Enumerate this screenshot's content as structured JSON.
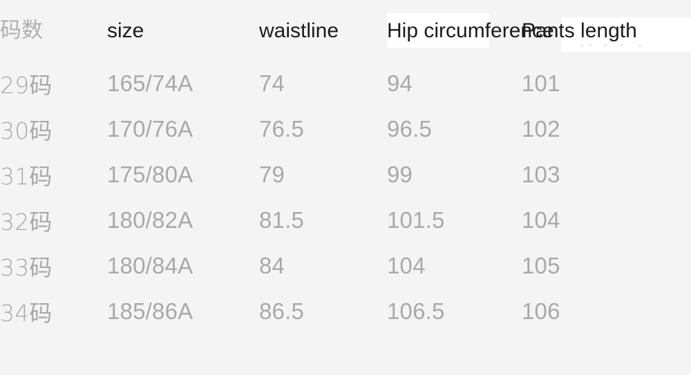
{
  "table": {
    "headers": [
      {
        "label": "码数",
        "style": "muted"
      },
      {
        "label": "size",
        "style": "dark"
      },
      {
        "label": "waistline",
        "style": "dark"
      },
      {
        "label": "Hip circumference",
        "style": "dark"
      },
      {
        "label": "Pants length",
        "style": "dark"
      }
    ],
    "rows": [
      {
        "code": "29码",
        "size": "165/74A",
        "waistline": "74",
        "hip": "94",
        "length": "101"
      },
      {
        "code": "30码",
        "size": "170/76A",
        "waistline": "76.5",
        "hip": "96.5",
        "length": "102"
      },
      {
        "code": "31码",
        "size": "175/80A",
        "waistline": "79",
        "hip": "99",
        "length": "103"
      },
      {
        "code": "32码",
        "size": "180/82A",
        "waistline": "81.5",
        "hip": "101.5",
        "length": "104"
      },
      {
        "code": "33码",
        "size": "180/84A",
        "waistline": "84",
        "hip": "104",
        "length": "105"
      },
      {
        "code": "34码",
        "size": "185/86A",
        "waistline": "86.5",
        "hip": "106.5",
        "length": "106"
      }
    ]
  },
  "colors": {
    "background": "#f4f4f4",
    "header_text": "#1b1b1b",
    "muted_text": "#b0b0b0",
    "data_text": "#a9a9a9",
    "highlight_band": "#ffffff"
  }
}
